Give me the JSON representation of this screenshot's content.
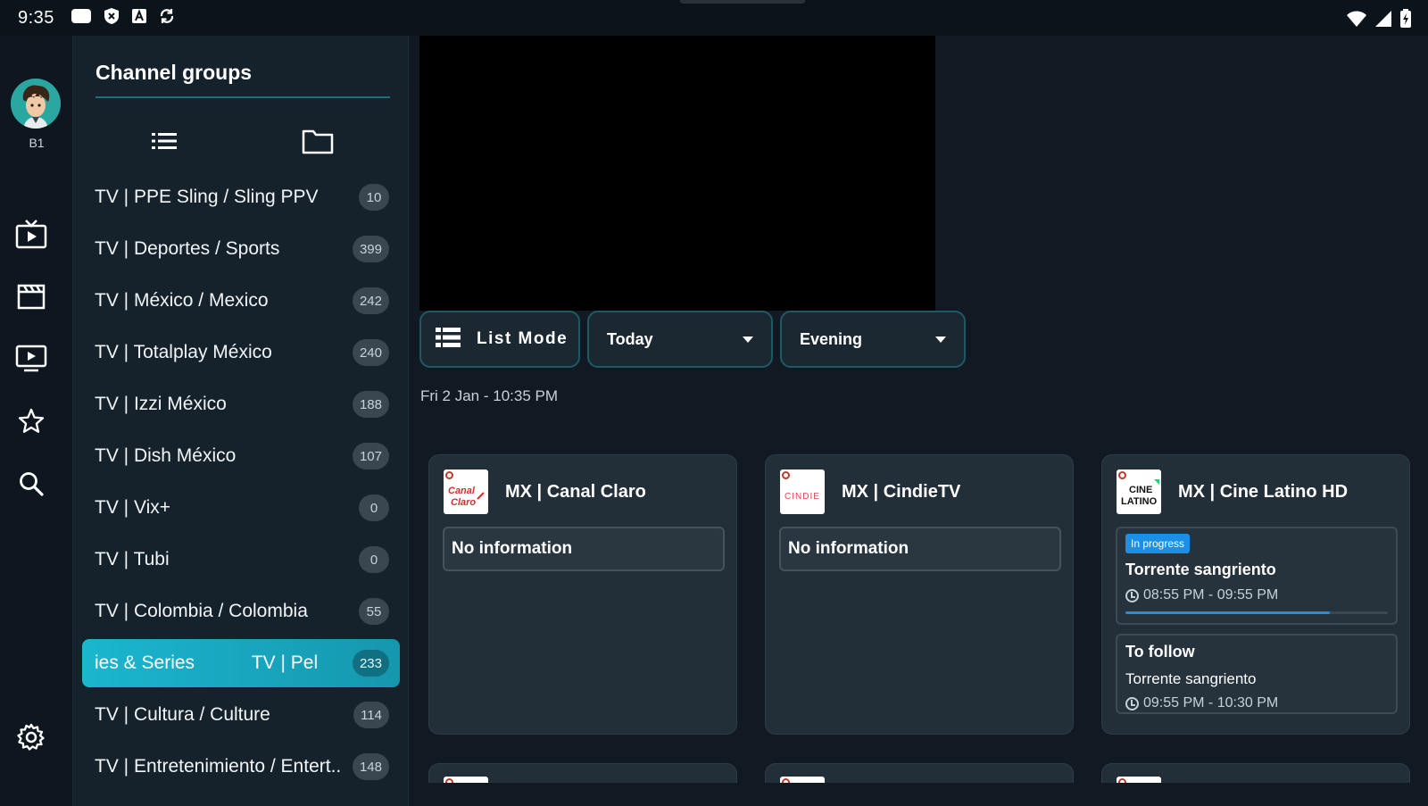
{
  "status_bar": {
    "time": "9:35",
    "left_icons": [
      "message-icon",
      "shield-x-icon",
      "font-a-icon",
      "sync-icon"
    ],
    "right_icons": [
      "wifi-icon",
      "signal-icon",
      "battery-icon"
    ]
  },
  "rail": {
    "profile_label": "B1",
    "items": [
      "live-tv-icon",
      "movies-icon",
      "series-icon",
      "favorites-icon",
      "search-icon"
    ],
    "settings_icon": "settings-icon"
  },
  "groups": {
    "title": "Channel groups",
    "items": [
      {
        "label": "TV | PPE Sling / Sling PPV",
        "count": "10"
      },
      {
        "label": "TV | Deportes / Sports",
        "count": "399"
      },
      {
        "label": "TV | México / Mexico",
        "count": "242"
      },
      {
        "label": "TV | Totalplay México",
        "count": "240"
      },
      {
        "label": "TV | Izzi México",
        "count": "188"
      },
      {
        "label": "TV | Dish México",
        "count": "107"
      },
      {
        "label": "TV | Vix+",
        "count": "0"
      },
      {
        "label": "TV | Tubi",
        "count": "0"
      },
      {
        "label": "TV | Colombia / Colombia",
        "count": "55"
      },
      {
        "label": "ies & Series           TV | Pel",
        "count": "233"
      },
      {
        "label": "TV | Cultura / Culture",
        "count": "114"
      },
      {
        "label": "TV | Entretenimiento / Entert..",
        "count": "148"
      }
    ]
  },
  "controls": {
    "list_mode_label": "List Mode",
    "day_label": "Today",
    "time_label": "Evening"
  },
  "date_line": "Fri 2 Jan - 10:35 PM",
  "cards": [
    {
      "name": "MX | Canal Claro",
      "logo_text": "Canal Claro",
      "info": "No information"
    },
    {
      "name": "MX | CindieTV",
      "logo_text": "CINDIE",
      "info": "No information"
    },
    {
      "name": "MX | Cine Latino HD",
      "logo_text": "CINE LATINO",
      "now": {
        "badge": "In progress",
        "title": "Torrente sangriento",
        "time": "08:55 PM - 09:55 PM",
        "progress": 0.78
      },
      "next": {
        "label": "To follow",
        "title": "Torrente sangriento",
        "time": "09:55 PM - 10:30 PM"
      }
    }
  ],
  "colors": {
    "accent": "#1bb6cf",
    "badge": "#1c8fe6",
    "background": "#111a22"
  }
}
